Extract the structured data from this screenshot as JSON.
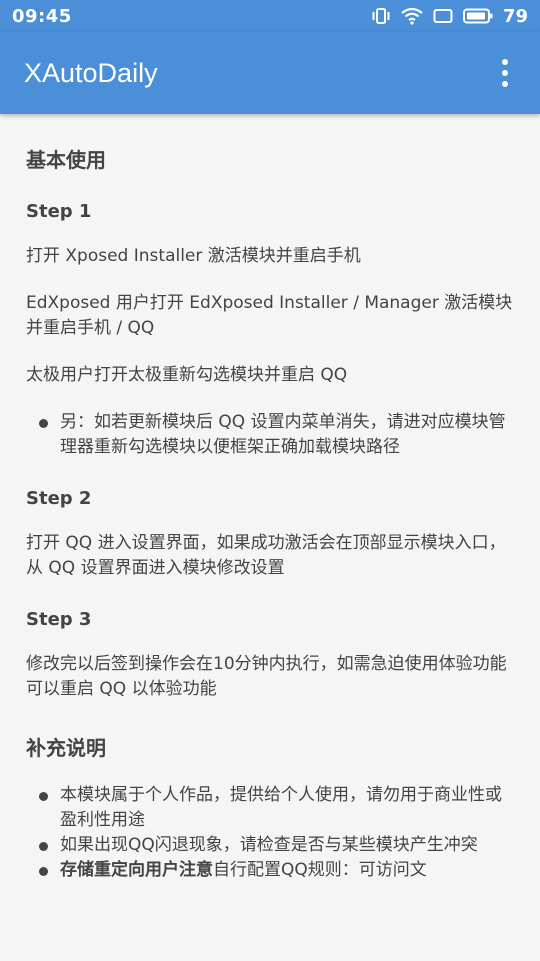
{
  "status_bar": {
    "time": "09:45",
    "battery": "79"
  },
  "app_bar": {
    "title": "XAutoDaily"
  },
  "content": {
    "section1_title": "基本使用",
    "step1_label": "Step 1",
    "step1_p1": "打开 Xposed Installer 激活模块并重启手机",
    "step1_p2": "EdXposed 用户打开 EdXposed Installer / Manager 激活模块并重启手机 / QQ",
    "step1_p3": "太极用户打开太极重新勾选模块并重启 QQ",
    "step1_bullet": "另：如若更新模块后 QQ 设置内菜单消失，请进对应模块管理器重新勾选模块以便框架正确加载模块路径",
    "step2_label": "Step 2",
    "step2_p1": "打开 QQ 进入设置界面，如果成功激活会在顶部显示模块入口，从 QQ 设置界面进入模块修改设置",
    "step3_label": "Step 3",
    "step3_p1": "修改完以后签到操作会在10分钟内执行，如需急迫使用体验功能可以重启 QQ 以体验功能",
    "section2_title": "补充说明",
    "notes": [
      {
        "text": "本模块属于个人作品，提供给个人使用，请勿用于商业性或盈利性用途"
      },
      {
        "text": "如果出现QQ闪退现象，请检查是否与某些模块产生冲突"
      },
      {
        "bold": "存储重定向用户注意",
        "text": "自行配置QQ规则：可访问文"
      }
    ]
  }
}
